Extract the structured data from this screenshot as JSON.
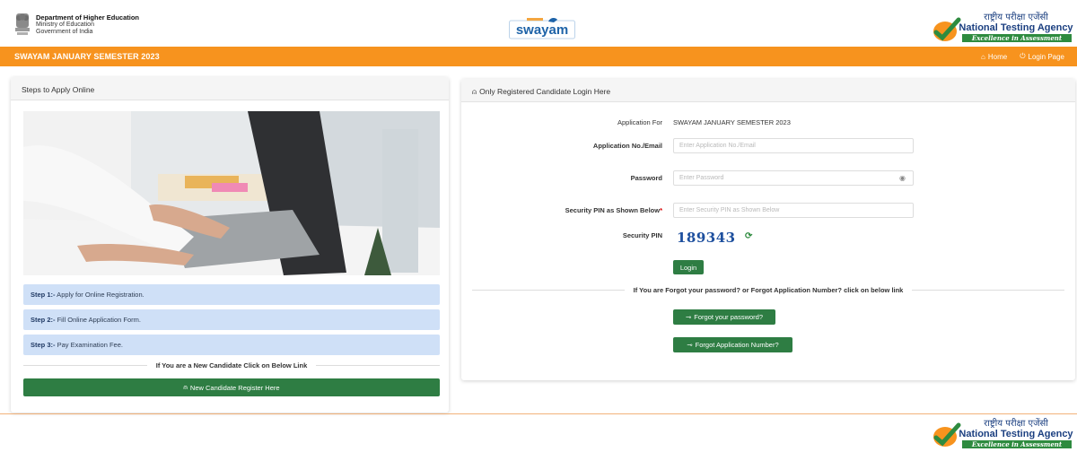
{
  "header": {
    "dept_line1": "Department of Higher Education",
    "dept_line2": "Ministry of Education",
    "dept_line3": "Government of India",
    "swayam_logo_text": "swayam",
    "nta_hindi": "राष्ट्रीय परीक्षा एजेंसी",
    "nta_english": "National Testing Agency",
    "nta_tagline": "Excellence in Assessment"
  },
  "nav": {
    "title": "SWAYAM JANUARY SEMESTER 2023",
    "home_label": "Home",
    "login_label": "Login Page"
  },
  "left_card": {
    "title": "Steps to Apply Online",
    "steps": [
      {
        "label": "Step 1:-",
        "text": " Apply for Online Registration."
      },
      {
        "label": "Step 2:-",
        "text": " Fill Online Application Form."
      },
      {
        "label": "Step 3:-",
        "text": " Pay Examination Fee."
      }
    ],
    "new_candidate_text": "If You are a New Candidate Click on Below Link",
    "register_button": "New Candidate Register Here"
  },
  "right_card": {
    "title": "Only Registered Candidate Login Here",
    "application_for_label": "Application For",
    "application_for_value": "SWAYAM JANUARY SEMESTER 2023",
    "app_no_label": "Application No./Email",
    "app_no_placeholder": "Enter Application No./Email",
    "password_label": "Password",
    "password_placeholder": "Enter Password",
    "security_pin_input_label": "Security PIN as Shown Below",
    "security_pin_required": "*",
    "security_pin_placeholder": "Enter Security PIN as Shown Below",
    "security_pin_label": "Security PIN",
    "security_pin_value": "189343",
    "login_button": "Login",
    "forgot_text": "If You are Forgot your password? or Forgot Application Number? click on below link",
    "forgot_password_button": "Forgot your password?",
    "forgot_app_no_button": "Forgot Application Number?"
  },
  "colors": {
    "nav_orange": "#f7931e",
    "button_green": "#2e7d43",
    "step_blue": "#cfe0f7",
    "captcha_blue": "#1d4f9e"
  }
}
